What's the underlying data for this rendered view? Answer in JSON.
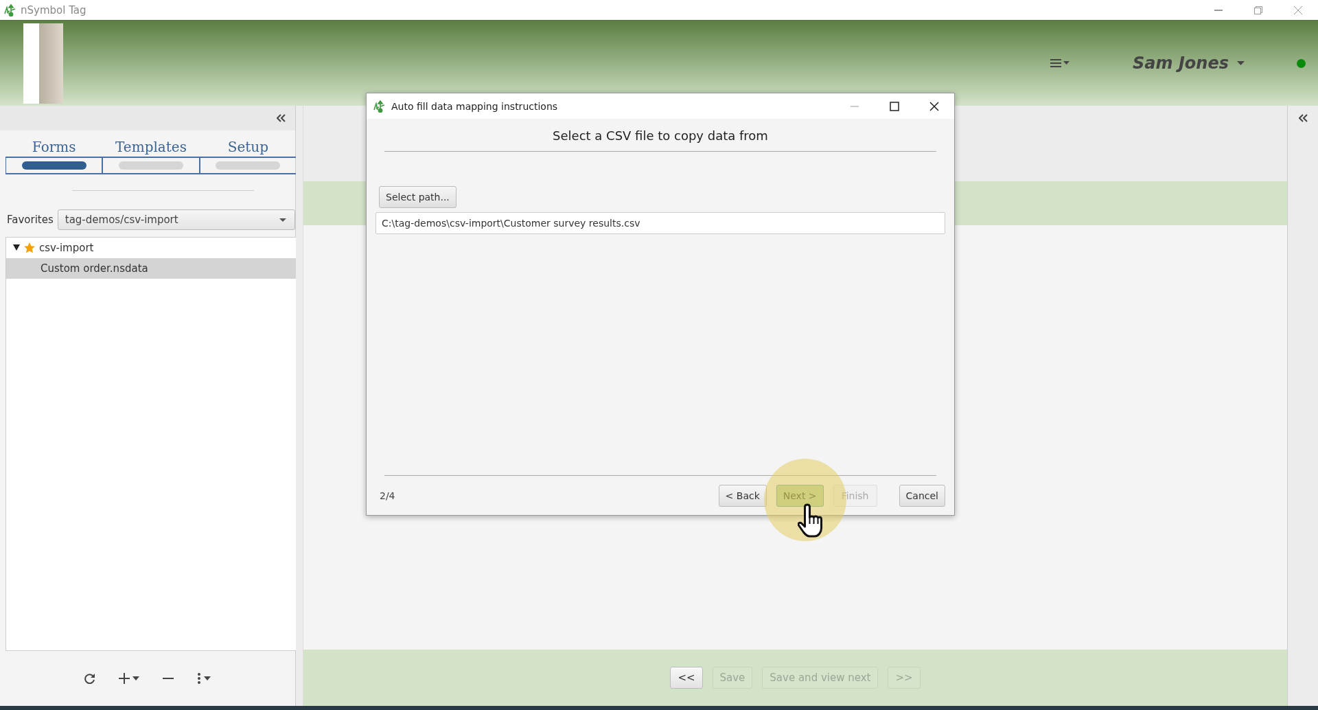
{
  "window": {
    "title": "nSymbol Tag"
  },
  "header": {
    "user": "Sam Jones",
    "online": true
  },
  "left_panel": {
    "tabs": [
      {
        "label": "Forms",
        "selected": true
      },
      {
        "label": "Templates",
        "selected": false
      },
      {
        "label": "Setup",
        "selected": false
      }
    ],
    "favorites": {
      "label": "Favorites",
      "value": "tag-demos/csv-import"
    },
    "tree": [
      {
        "label": "csv-import",
        "starred": true,
        "expanded": true,
        "selected": false,
        "children": [
          {
            "label": "Custom order.nsdata",
            "starred": false,
            "selected": true
          }
        ]
      }
    ]
  },
  "dialog": {
    "title": "Auto fill data mapping instructions",
    "heading": "Select a CSV file to copy data from",
    "select_button": "Select path...",
    "path": "C:\\tag-demos\\csv-import\\Customer survey results.csv",
    "step": "2/4",
    "buttons": [
      {
        "label": "< Back",
        "disabled": false,
        "hovered": false
      },
      {
        "label": "Next >",
        "disabled": false,
        "hovered": true
      },
      {
        "label": "Finish",
        "disabled": true,
        "hovered": false
      },
      {
        "label": "Cancel",
        "disabled": false,
        "hovered": false
      }
    ]
  },
  "footer_buttons": [
    {
      "label": "<<",
      "disabled": false
    },
    {
      "label": "Save",
      "disabled": true
    },
    {
      "label": "Save and view next",
      "disabled": true
    },
    {
      "label": ">>",
      "disabled": true
    }
  ]
}
